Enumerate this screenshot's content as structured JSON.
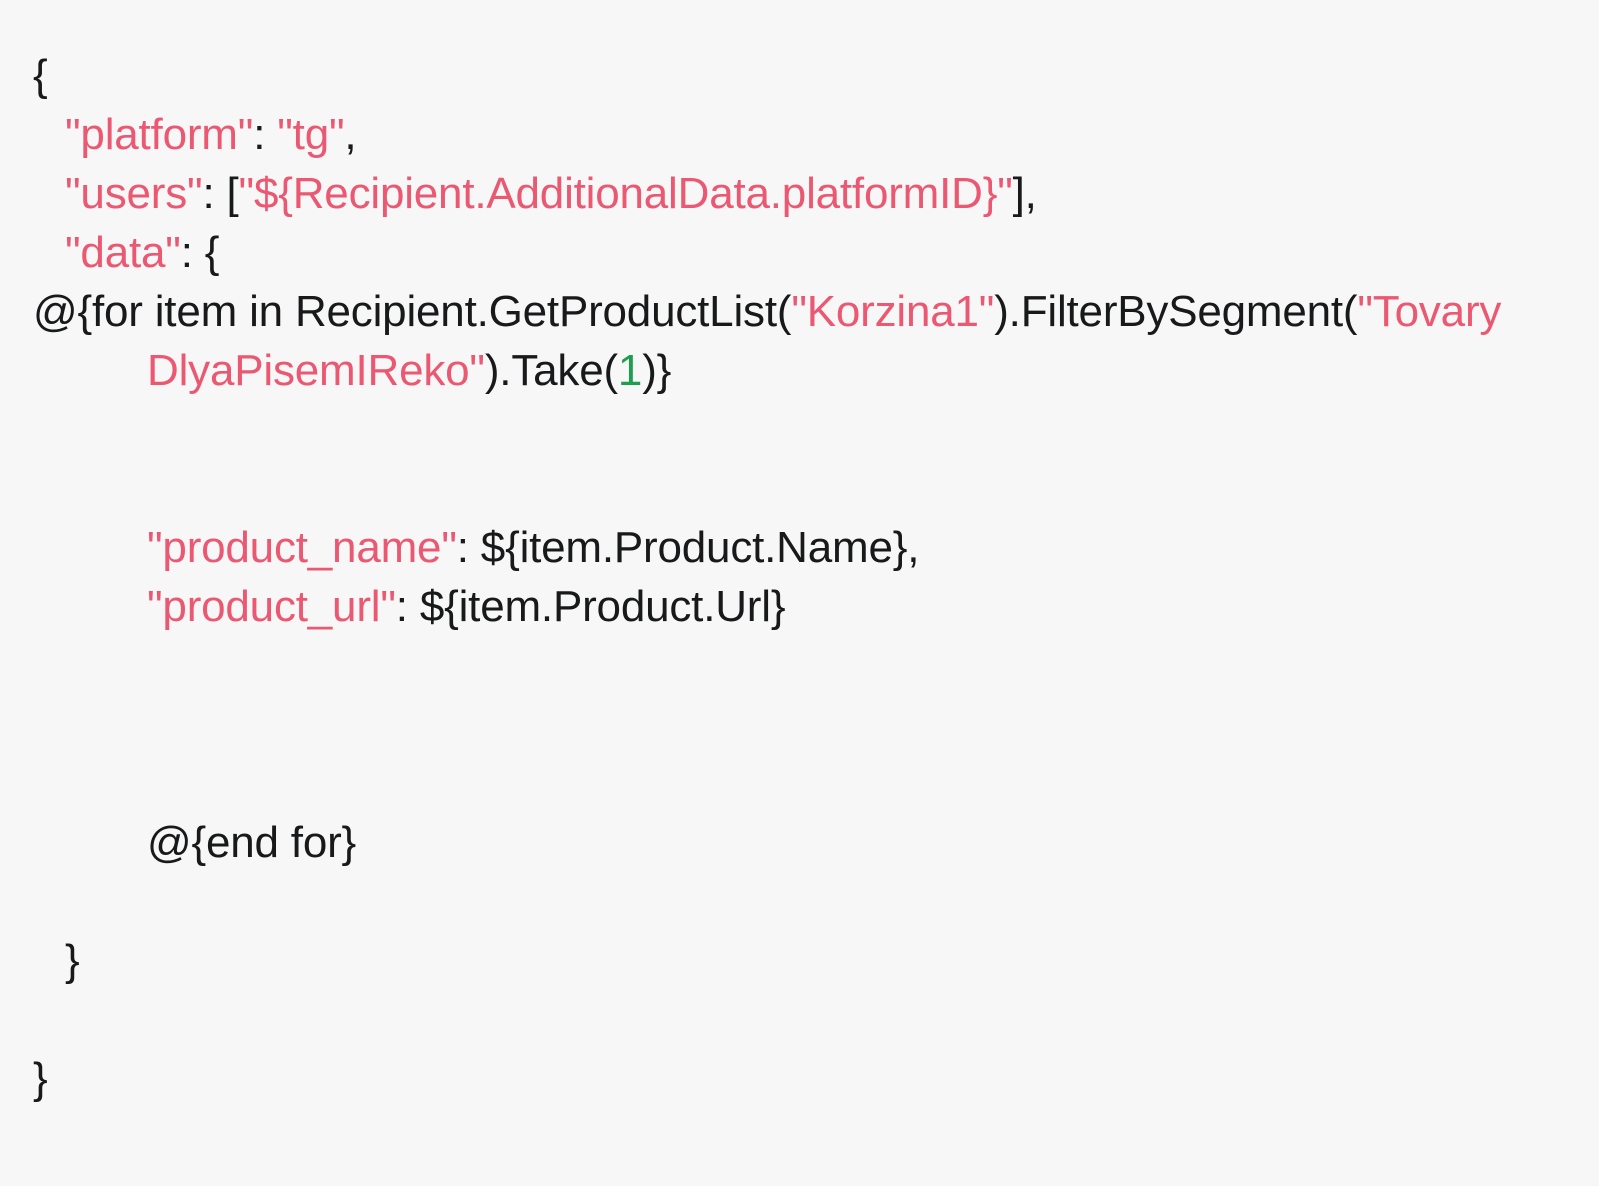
{
  "editor": {
    "background_color": "#f7f7f7",
    "default_text_color": "#18191a",
    "string_color": "#ea5872",
    "number_color": "#1f9d50",
    "language": "json-template"
  },
  "code": {
    "line_1": "{",
    "line_2": {
      "key": "\"platform\"",
      "colon": ": ",
      "value": "\"tg\"",
      "comma": ","
    },
    "line_3": {
      "key": "\"users\"",
      "colon": ": ",
      "open_bracket": "[",
      "value": "\"${Recipient.AdditionalData.platformID}\"",
      "close": "],"
    },
    "line_4": {
      "key": "\"data\"",
      "colon": ": ",
      "open_brace": "{"
    },
    "line_5": {
      "directive_open": "@{for item in",
      "expr_head": " Recipient.GetProductList(",
      "arg1": "\"Korzina1\"",
      "expr_mid": ").FilterBySegment(",
      "arg2": "\"Tovary DlyaPisemIReko\"",
      "expr_tail": ").Take(",
      "take_count": "1",
      "directive_close": ")}"
    },
    "line_6": {
      "key": "\"product_name\"",
      "colon": ": ",
      "value": "${item.Product.Name}",
      "comma": ","
    },
    "line_7": {
      "key": "\"product_url\"",
      "colon": ": ",
      "value": "${item.Product.Url}"
    },
    "line_8": "@{end for}",
    "line_9": "}",
    "line_10": "}"
  }
}
